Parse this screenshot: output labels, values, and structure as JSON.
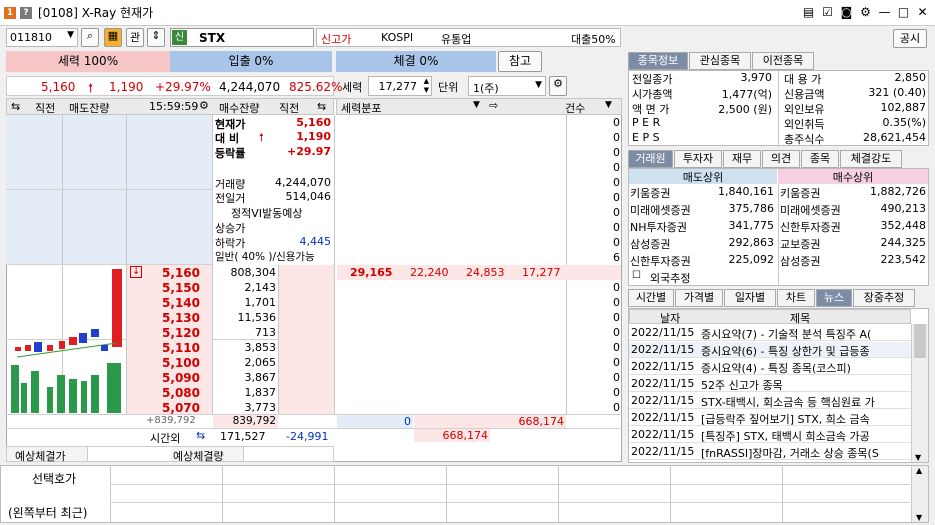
{
  "window": {
    "badge1": "1",
    "badge2": "?",
    "title": "[0108] X-Ray 현재가"
  },
  "toolbar": {
    "code": "011810",
    "gwan": "관",
    "sin": "신",
    "name": "STX",
    "new_high": "신고가",
    "market": "KOSPI",
    "sector": "유통업",
    "loan": "대출50%",
    "gongsi": "공시"
  },
  "force": {
    "sell": "세력 100%",
    "buy": "입출 0%",
    "trade": "체결 0%",
    "ref": "참고"
  },
  "price_line": {
    "price": "5,160",
    "change": "1,190",
    "rate": "+29.97%",
    "volume": "4,244,070",
    "ratio": "825.62%"
  },
  "force_ctl": {
    "label": "세력",
    "value": "17,277",
    "unit_label": "단위",
    "unit": "1(주)"
  },
  "ob_header": {
    "c1": "직전",
    "c2": "매도잔량",
    "time": "15:59:59",
    "c4": "매수잔량",
    "c5": "직전",
    "dist": "세력분포",
    "count": "건수"
  },
  "info": [
    {
      "label": "현재가",
      "value": "5,160",
      "cls": "r"
    },
    {
      "label": "대 비",
      "value": "1,190",
      "cls": "r"
    },
    {
      "label": "등락률",
      "value": "+29.97",
      "cls": "r"
    },
    {
      "label": "거래량",
      "value": "4,244,070",
      "cls": ""
    },
    {
      "label": "전일거",
      "value": "514,046",
      "cls": ""
    },
    {
      "label": "정적VI발동예상",
      "value": "",
      "cls": ""
    },
    {
      "label": "상승가",
      "value": "",
      "cls": ""
    },
    {
      "label": "하락가",
      "value": "4,445",
      "cls": "b"
    },
    {
      "label": "일반( 40% )/신용가능",
      "value": "",
      "cls": ""
    }
  ],
  "bids": [
    {
      "price": "5,160",
      "qty": "808,304"
    },
    {
      "price": "5,150",
      "qty": "2,143"
    },
    {
      "price": "5,140",
      "qty": "1,701"
    },
    {
      "price": "5,130",
      "qty": "11,536"
    },
    {
      "price": "5,120",
      "qty": "713"
    },
    {
      "price": "5,110",
      "qty": "3,853"
    },
    {
      "price": "5,100",
      "qty": "2,065"
    },
    {
      "price": "5,090",
      "qty": "3,867"
    },
    {
      "price": "5,080",
      "qty": "1,837"
    },
    {
      "price": "5,070",
      "qty": "3,773"
    }
  ],
  "dist_counts": [
    "0",
    "0",
    "0",
    "0",
    "0",
    "0",
    "0",
    "0",
    "0",
    "6",
    "0",
    "0",
    "0",
    "0",
    "0",
    "0",
    "0",
    "0",
    "0",
    "0"
  ],
  "dist_highlight": {
    "a": "29,165",
    "b": "22,240",
    "c": "24,853",
    "d": "17,277"
  },
  "ob_totals": {
    "left": "+839,792",
    "bid_total": "839,792",
    "center": "0",
    "right": "668,174",
    "overtime_label": "시간외",
    "overtime_qty": "171,527",
    "overtime_diff": "-24,991",
    "total2": "668,174"
  },
  "expected": {
    "l1": "예상체결가",
    "l2": "예상체결량"
  },
  "select_box": {
    "l1": "선택호가",
    "l2": "(왼쪽부터 최근)"
  },
  "right_tabs": [
    "종목정보",
    "관심종목",
    "이전종목"
  ],
  "stock_info": [
    {
      "k1": "전일종가",
      "v1": "3,970",
      "k2": "대 용 가",
      "v2": "2,850"
    },
    {
      "k1": "시가총액",
      "v1": "1,477(억)",
      "k2": "신용금액",
      "v2": "321    (0.40)"
    },
    {
      "k1": "액 면 가",
      "v1": "2,500 (원)",
      "k2": "외인보유",
      "v2": "102,887"
    },
    {
      "k1": "P E R",
      "v1": "",
      "k2": "외인취득",
      "v2": "0.35(%)"
    },
    {
      "k1": "E P S",
      "v1": "",
      "k2": "총주식수",
      "v2": "28,621,454"
    }
  ],
  "broker_tabs": [
    "거래원",
    "투자자",
    "재무",
    "의견",
    "종목",
    "체결강도"
  ],
  "broker_head": {
    "sell": "매도상위",
    "buy": "매수상위"
  },
  "brokers": [
    {
      "sn": "키움증권",
      "sv": "1,840,161",
      "bn": "키움증권",
      "bv": "1,882,726"
    },
    {
      "sn": "미래에셋증권",
      "sv": "375,786",
      "bn": "미래에셋증권",
      "bv": "490,213"
    },
    {
      "sn": "NH투자증권",
      "sv": "341,775",
      "bn": "신한투자증권",
      "bv": "352,448"
    },
    {
      "sn": "삼성증권",
      "sv": "292,863",
      "bn": "교보증권",
      "bv": "244,325"
    },
    {
      "sn": "신한투자증권",
      "sv": "225,092",
      "bn": "삼성증권",
      "bv": "223,542"
    }
  ],
  "foreign_est": "외국추정",
  "news_tabs": [
    "시간별",
    "가격별",
    "일자별",
    "차트",
    "뉴스",
    "장중추정"
  ],
  "news_head": {
    "date": "날자",
    "title": "제목"
  },
  "news": [
    {
      "date": "2022/11/15",
      "title": "증시요약(7) - 기술적 분석 특징주 A("
    },
    {
      "date": "2022/11/15",
      "title": "증시요약(6) - 특징 상한가 및 급등종"
    },
    {
      "date": "2022/11/15",
      "title": "증시요약(4) - 특징 종목(코스피)"
    },
    {
      "date": "2022/11/15",
      "title": "52주 신고가 종목"
    },
    {
      "date": "2022/11/15",
      "title": "STX-태백시, 회소금속 등 핵심원료 가"
    },
    {
      "date": "2022/11/15",
      "title": "[급등락주 짚어보기] STX, 희소 금속"
    },
    {
      "date": "2022/11/15",
      "title": "[특징주] STX, 태백시 희소금속 가공"
    },
    {
      "date": "2022/11/15",
      "title": "[fnRASSI]장마감, 거래소 상승 종목(S"
    }
  ],
  "colors": {
    "red": "#d00000",
    "blue": "#0030c0",
    "pink": "#fde6e6",
    "lightblue": "#e4ecf8"
  }
}
